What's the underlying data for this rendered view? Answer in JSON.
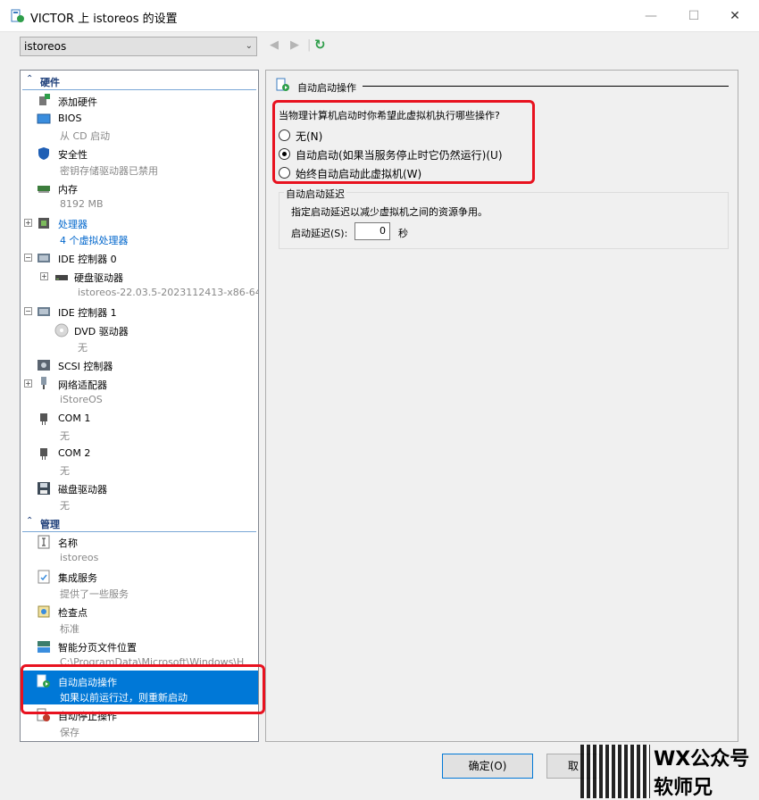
{
  "window": {
    "title": "VICTOR 上 istoreos 的设置",
    "min": "—",
    "max": "☐",
    "close": "✕"
  },
  "toolbar": {
    "vm_select": "istoreos",
    "back": "◀",
    "forward": "▶",
    "refresh": "↻"
  },
  "tree": {
    "hardware_header": "硬件",
    "management_header": "管理",
    "hardware": [
      {
        "name": "添加硬件",
        "sub": ""
      },
      {
        "name": "BIOS",
        "sub": "从 CD 启动"
      },
      {
        "name": "安全性",
        "sub": "密钥存储驱动器已禁用"
      },
      {
        "name": "内存",
        "sub": "8192 MB"
      },
      {
        "name": "处理器",
        "sub": "4 个虚拟处理器"
      },
      {
        "name": "IDE 控制器 0",
        "sub": ""
      },
      {
        "name": "硬盘驱动器",
        "sub": "istoreos-22.03.5-2023112413-x86-64..."
      },
      {
        "name": "IDE 控制器 1",
        "sub": ""
      },
      {
        "name": "DVD 驱动器",
        "sub": "无"
      },
      {
        "name": "SCSI 控制器",
        "sub": ""
      },
      {
        "name": "网络适配器",
        "sub": "iStoreOS"
      },
      {
        "name": "COM 1",
        "sub": "无"
      },
      {
        "name": "COM 2",
        "sub": "无"
      },
      {
        "name": "磁盘驱动器",
        "sub": "无"
      }
    ],
    "management": [
      {
        "name": "名称",
        "sub": "istoreos"
      },
      {
        "name": "集成服务",
        "sub": "提供了一些服务"
      },
      {
        "name": "检查点",
        "sub": "标准"
      },
      {
        "name": "智能分页文件位置",
        "sub": "C:\\ProgramData\\Microsoft\\Windows\\H"
      },
      {
        "name": "自动启动操作",
        "sub": "如果以前运行过，则重新启动"
      },
      {
        "name": "自动停止操作",
        "sub": "保存"
      }
    ]
  },
  "panel": {
    "title": "自动启动操作",
    "question": "当物理计算机启动时你希望此虚拟机执行哪些操作?",
    "options": [
      {
        "label": "无(N)",
        "selected": false
      },
      {
        "label": "自动启动(如果当服务停止时它仍然运行)(U)",
        "selected": true
      },
      {
        "label": "始终自动启动此虚拟机(W)",
        "selected": false
      }
    ],
    "delay_group": "自动启动延迟",
    "delay_desc": "指定启动延迟以减少虚拟机之间的资源争用。",
    "delay_label": "启动延迟(S):",
    "delay_value": "0",
    "delay_unit": "秒"
  },
  "footer": {
    "ok": "确定(O)",
    "cancel": "取"
  },
  "watermark": {
    "line1": "WX公众号",
    "line2": "软师兄"
  },
  "colors": {
    "selection": "#0078d7",
    "highlight_box": "#e8121f",
    "section_text": "#1e3f7a"
  }
}
